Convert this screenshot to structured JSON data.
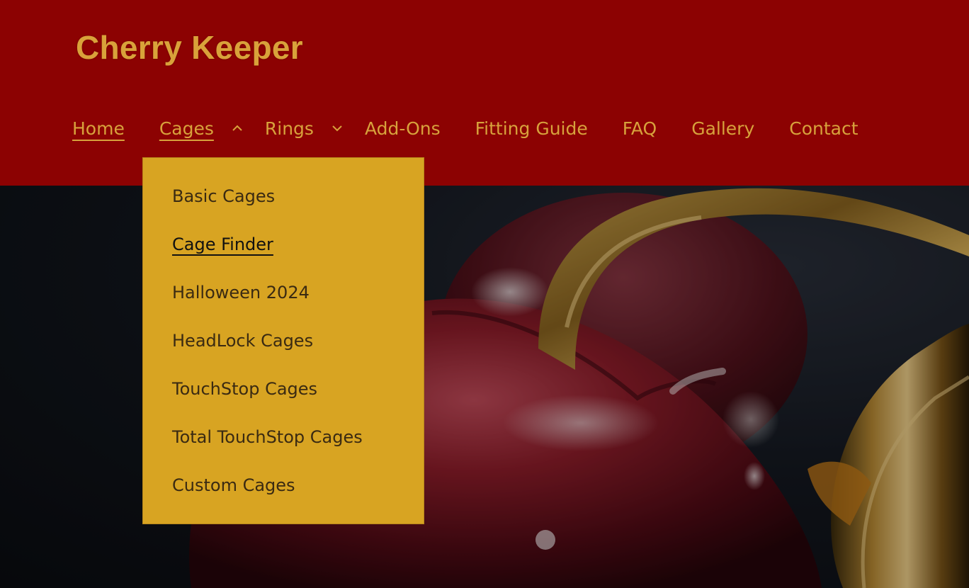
{
  "header": {
    "logo_text": "Cherry Keeper",
    "bg_color": "#8c0202",
    "accent_color": "#d7a23c"
  },
  "nav": {
    "items": [
      {
        "label": "Home",
        "active": true,
        "dropdown": false
      },
      {
        "label": "Cages",
        "active": false,
        "dropdown": true,
        "open": true
      },
      {
        "label": "Rings",
        "active": false,
        "dropdown": true,
        "open": false
      },
      {
        "label": "Add-Ons",
        "active": false,
        "dropdown": false
      },
      {
        "label": "Fitting Guide",
        "active": false,
        "dropdown": false
      },
      {
        "label": "FAQ",
        "active": false,
        "dropdown": false
      },
      {
        "label": "Gallery",
        "active": false,
        "dropdown": false
      },
      {
        "label": "Contact",
        "active": false,
        "dropdown": false
      }
    ]
  },
  "dropdown": {
    "bg_color": "#d8a422",
    "items": [
      {
        "label": "Basic Cages",
        "current": false
      },
      {
        "label": "Cage Finder",
        "current": true
      },
      {
        "label": "Halloween 2024",
        "current": false
      },
      {
        "label": "HeadLock Cages",
        "current": false
      },
      {
        "label": "TouchStop Cages",
        "current": false
      },
      {
        "label": "Total TouchStop Cages",
        "current": false
      },
      {
        "label": "Custom Cages",
        "current": false
      }
    ]
  },
  "hero": {
    "image_subject": "cherry-with-golden-lock"
  }
}
